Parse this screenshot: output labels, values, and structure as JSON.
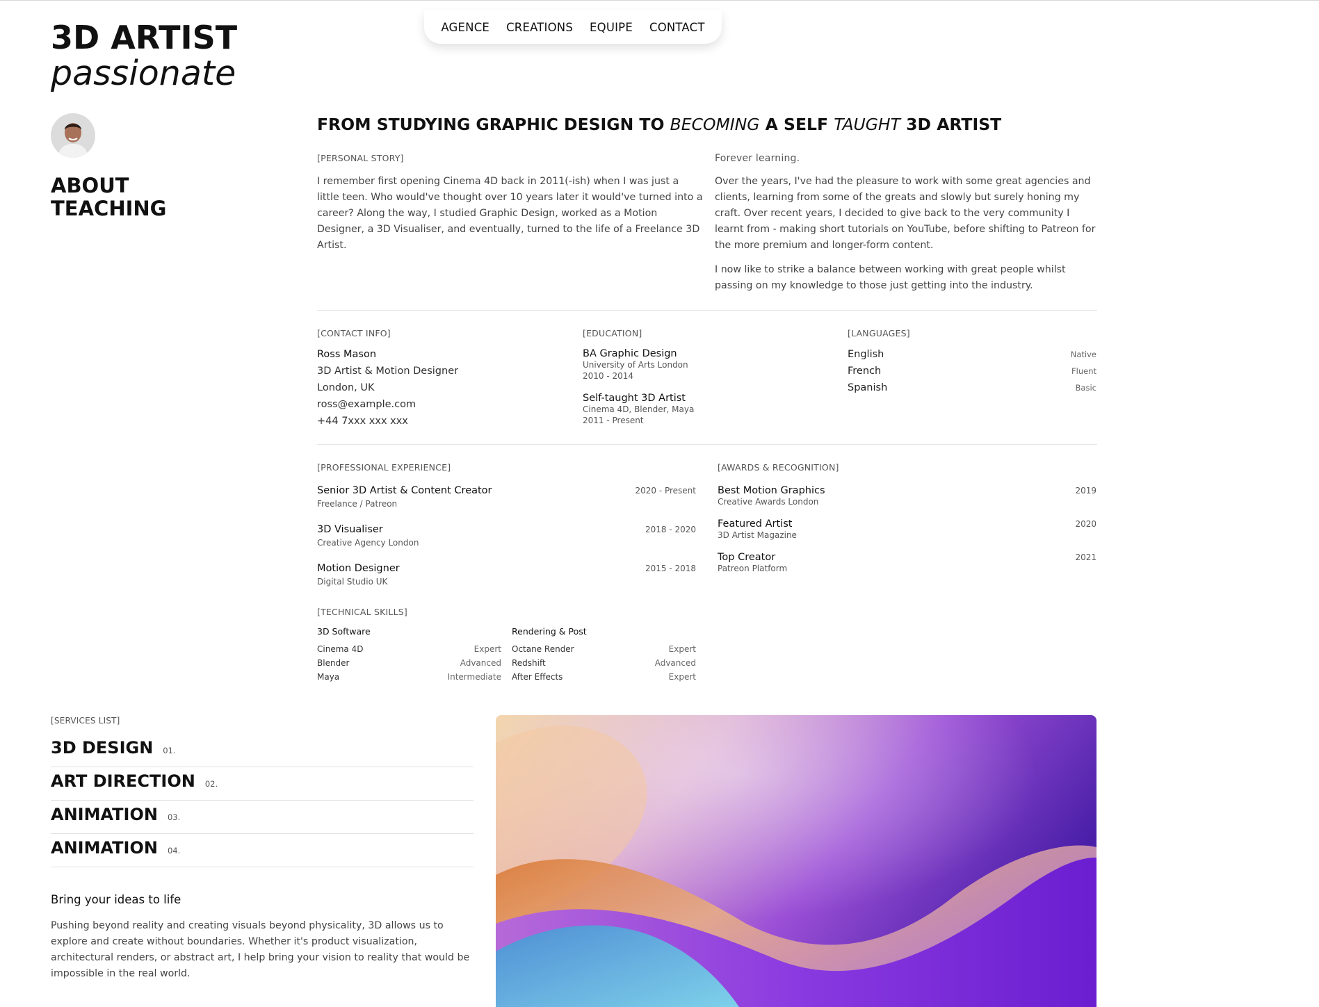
{
  "brand": {
    "title": "3D ARTIST",
    "subtitle": "passionate"
  },
  "nav": {
    "items": [
      "AGENCE",
      "CREATIONS",
      "EQUIPE",
      "CONTACT"
    ]
  },
  "sidebar": {
    "heading_line1": "ABOUT",
    "heading_line2": "TEACHING"
  },
  "headline": {
    "part1": "FROM STUDYING GRAPHIC DESIGN TO ",
    "italic1": "BECOMING",
    "part2": " A SELF ",
    "italic2": "TAUGHT",
    "part3": " 3D ARTIST"
  },
  "story": {
    "label": "[PERSONAL STORY]",
    "text": "I remember first opening Cinema 4D back in 2011(-ish) when I was just a little teen. Who would've thought over 10 years later it would've turned into a career? Along the way, I studied Graphic Design, worked as a Motion Designer, a 3D Visualiser, and eventually, turned to the life of a Freelance 3D Artist."
  },
  "learning": {
    "label": "Forever learning.",
    "p1": "Over the years, I've had the pleasure to work with some great agencies and clients, learning from some of the greats and slowly but surely honing my craft. Over recent years, I decided to give back to the very community I learnt from - making short tutorials on YouTube, before shifting to Patreon for the more premium and longer-form content.",
    "p2": "I now like to strike a balance between working with great people whilst passing on my knowledge to those just getting into the industry."
  },
  "contact": {
    "label": "[CONTACT INFO]",
    "lines": [
      "Ross Mason",
      "3D Artist & Motion Designer",
      "London, UK",
      "ross@example.com",
      "+44 7xxx xxx xxx"
    ]
  },
  "education": {
    "label": "[EDUCATION]",
    "items": [
      {
        "title": "BA Graphic Design",
        "place": "University of Arts London",
        "years": "2010 - 2014"
      },
      {
        "title": "Self-taught 3D Artist",
        "place": "Cinema 4D, Blender, Maya",
        "years": "2011 - Present"
      }
    ]
  },
  "languages": {
    "label": "[LANGUAGES]",
    "items": [
      {
        "name": "English",
        "level": "Native"
      },
      {
        "name": "French",
        "level": "Fluent"
      },
      {
        "name": "Spanish",
        "level": "Basic"
      }
    ]
  },
  "experience": {
    "label": "[PROFESSIONAL EXPERIENCE]",
    "items": [
      {
        "title": "Senior 3D Artist & Content Creator",
        "org": "Freelance / Patreon",
        "dates": "2020 - Present"
      },
      {
        "title": "3D Visualiser",
        "org": "Creative Agency London",
        "dates": "2018 - 2020"
      },
      {
        "title": "Motion Designer",
        "org": "Digital Studio UK",
        "dates": "2015 - 2018"
      }
    ]
  },
  "awards": {
    "label": "[AWARDS & RECOGNITION]",
    "items": [
      {
        "title": "Best Motion Graphics",
        "org": "Creative Awards London",
        "year": "2019"
      },
      {
        "title": "Featured Artist",
        "org": "3D Artist Magazine",
        "year": "2020"
      },
      {
        "title": "Top Creator",
        "org": "Patreon Platform",
        "year": "2021"
      }
    ]
  },
  "skills": {
    "label": "[TECHNICAL SKILLS]",
    "groups": [
      {
        "heading": "3D Software",
        "items": [
          {
            "name": "Cinema 4D",
            "level": "Expert"
          },
          {
            "name": "Blender",
            "level": "Advanced"
          },
          {
            "name": "Maya",
            "level": "Intermediate"
          }
        ]
      },
      {
        "heading": "Rendering & Post",
        "items": [
          {
            "name": "Octane Render",
            "level": "Expert"
          },
          {
            "name": "Redshift",
            "level": "Advanced"
          },
          {
            "name": "After Effects",
            "level": "Expert"
          }
        ]
      }
    ]
  },
  "services": {
    "label": "[SERVICES LIST]",
    "items": [
      {
        "name": "3D DESIGN",
        "num": "01."
      },
      {
        "name": "ART DIRECTION",
        "num": "02."
      },
      {
        "name": "ANIMATION",
        "num": "03."
      },
      {
        "name": "ANIMATION",
        "num": "04."
      }
    ]
  },
  "cta": {
    "title": "Bring your ideas to life",
    "body": "Pushing beyond reality and creating visuals beyond physicality, 3D allows us to explore and create without boundaries. Whether it's product visualization, architectural renders, or abstract art, I help bring your vision to reality that would be impossible in the real world."
  },
  "colors": {
    "text": "#111111",
    "muted": "#555555",
    "divider": "#e5e5e5",
    "hero_purple": "#7a2ee0",
    "hero_orange": "#e08a3c",
    "hero_blue": "#6ab8e6"
  }
}
